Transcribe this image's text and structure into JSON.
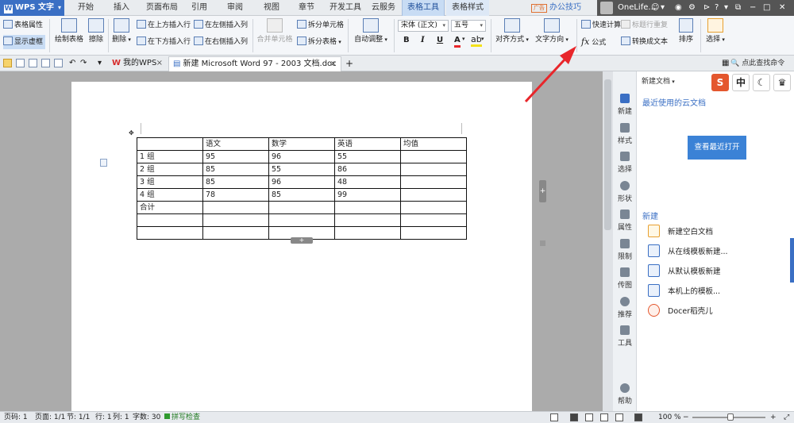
{
  "app": {
    "name": "WPS 文字"
  },
  "menu_tabs": [
    "开始",
    "插入",
    "页面布局",
    "引用",
    "审阅",
    "视图",
    "章节",
    "开发工具",
    "云服务",
    "表格工具",
    "表格样式"
  ],
  "menu_active": "表格工具",
  "top_right": {
    "ad": "广告",
    "tips": "办公技巧",
    "user": "OneLife..."
  },
  "ribbon": {
    "table_props": "表格属性",
    "show_gridlines": "显示虚框",
    "draw_table": "绘制表格",
    "erase": "擦除",
    "delete": "删除",
    "insert_above": "在上方插入行",
    "insert_below": "在下方插入行",
    "insert_left": "在左侧插入列",
    "insert_right": "在右侧插入列",
    "merge_cells": "合并单元格",
    "split_cells": "拆分单元格",
    "split_table": "拆分表格",
    "auto_fit": "自动调整",
    "font_name": "宋体 (正文)",
    "font_size": "五号",
    "bold": "B",
    "italic": "I",
    "underline": "U",
    "font_color": "A",
    "align": "对齐方式",
    "text_dir": "文字方向",
    "quick_calc": "快速计算",
    "formula": "公式",
    "repeat_header": "标题行重复",
    "to_text": "转换成文本",
    "sort": "排序",
    "select": "选择"
  },
  "doc_tabs": [
    {
      "label": "我的WPS",
      "close": "×"
    },
    {
      "label": "新建 Microsoft Word 97 - 2003 文档.doc *",
      "close": "×"
    }
  ],
  "find_command": "点此查找命令",
  "table": {
    "rows": [
      [
        "",
        "语文",
        "数学",
        "英语",
        "均值"
      ],
      [
        "1 组",
        "95",
        "96",
        "55",
        ""
      ],
      [
        "2 组",
        "85",
        "55",
        "86",
        ""
      ],
      [
        "3 组",
        "85",
        "96",
        "48",
        ""
      ],
      [
        "4 组",
        "78",
        "85",
        "99",
        ""
      ],
      [
        "合计",
        "",
        "",
        "",
        ""
      ],
      [
        "",
        "",
        "",
        "",
        ""
      ],
      [
        "",
        "",
        "",
        "",
        ""
      ]
    ],
    "add_col": "+",
    "add_row": "+"
  },
  "side_strip": [
    "新建",
    "样式",
    "选择",
    "形状",
    "属性",
    "限制",
    "传图",
    "推荐",
    "工具",
    "帮助"
  ],
  "pane": {
    "title": "新建文档",
    "skins": [
      "S",
      "中",
      "☾",
      "♛"
    ],
    "recent_heading": "最近使用的云文档",
    "open_recent": "查看最近打开",
    "new_heading": "新建",
    "new_items": [
      "新建空白文档",
      "从在线模板新建...",
      "从默认模板新建",
      "本机上的模板...",
      "Docer稻壳儿"
    ]
  },
  "watermark": {
    "main": "Bai 经验",
    "sub": "jingyan.baidu.com"
  },
  "status": {
    "page_no": "页码: 1",
    "pages": "页面: 1/1",
    "section": "节: 1/1",
    "row": "行: 1",
    "col": "列: 1",
    "words": "字数: 30",
    "spell": "拼写检查",
    "zoom": "100 %",
    "zoom_out": "−",
    "zoom_in": "+"
  },
  "colors": {
    "accent": "#3a6fc4",
    "arrow": "#e8262b",
    "open_button": "#3b82d6"
  }
}
